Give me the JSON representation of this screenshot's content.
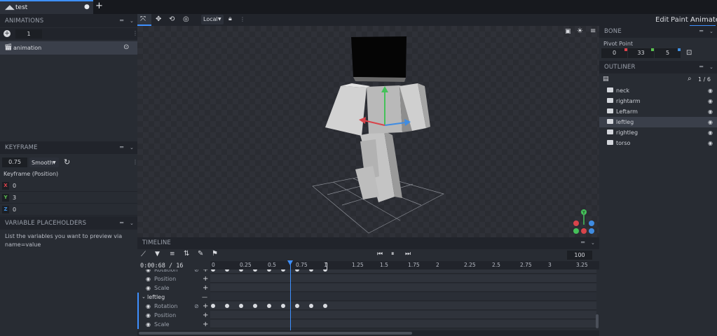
{
  "tab": {
    "title": "test",
    "add": "+"
  },
  "modes": {
    "edit": "Edit",
    "paint": "Paint",
    "animate": "Animate"
  },
  "toolbar": {
    "space": "Local"
  },
  "animations": {
    "title": "ANIMATIONS",
    "count": "1",
    "items": [
      {
        "name": "animation"
      }
    ]
  },
  "keyframe": {
    "title": "KEYFRAME",
    "time": "0.75",
    "interpolation": "Smooth",
    "channel_label": "Keyframe (Position)",
    "axes": [
      {
        "axis": "X",
        "value": "0",
        "color": "#e0424b"
      },
      {
        "axis": "Y",
        "value": "3",
        "color": "#5ac14f"
      },
      {
        "axis": "Z",
        "value": "0",
        "color": "#3e8ee0"
      }
    ]
  },
  "variables": {
    "title": "VARIABLE PLACEHOLDERS",
    "text": "List the variables you want to preview via name=value"
  },
  "bone": {
    "title": "BONE",
    "pivot_label": "Pivot Point",
    "pivot": [
      "0",
      "33",
      "5"
    ]
  },
  "outliner": {
    "title": "OUTLINER",
    "count": "1 / 6",
    "items": [
      {
        "name": "neck",
        "selected": false
      },
      {
        "name": "rightarm",
        "selected": false
      },
      {
        "name": "Leftarm",
        "selected": false
      },
      {
        "name": "leftleg",
        "selected": true
      },
      {
        "name": "rightleg",
        "selected": false
      },
      {
        "name": "torso",
        "selected": false
      }
    ]
  },
  "timeline": {
    "title": "TIMELINE",
    "time": "0:00:68",
    "frames": "/ 16",
    "speed": "100",
    "ticks": [
      "0",
      "0.25",
      "0.5",
      "0.75",
      "1",
      "1.25",
      "1.5",
      "1.75",
      "2",
      "2.25",
      "2.5",
      "2.75",
      "3",
      "3.25"
    ],
    "playhead_time": 0.69,
    "tracks": [
      {
        "label": "Rotation",
        "partial": true
      },
      {
        "label": "Position"
      },
      {
        "label": "Scale"
      },
      {
        "label": "leftleg",
        "group": true
      },
      {
        "label": "Rotation"
      },
      {
        "label": "Position"
      },
      {
        "label": "Scale"
      }
    ],
    "keyframes_upper": [
      0,
      0.125,
      0.25,
      0.375,
      0.5,
      0.625,
      0.75,
      0.875,
      1.0
    ],
    "keyframes_rotation": [
      0,
      0.125,
      0.25,
      0.375,
      0.5,
      0.625,
      0.75,
      0.875,
      1.0
    ]
  }
}
